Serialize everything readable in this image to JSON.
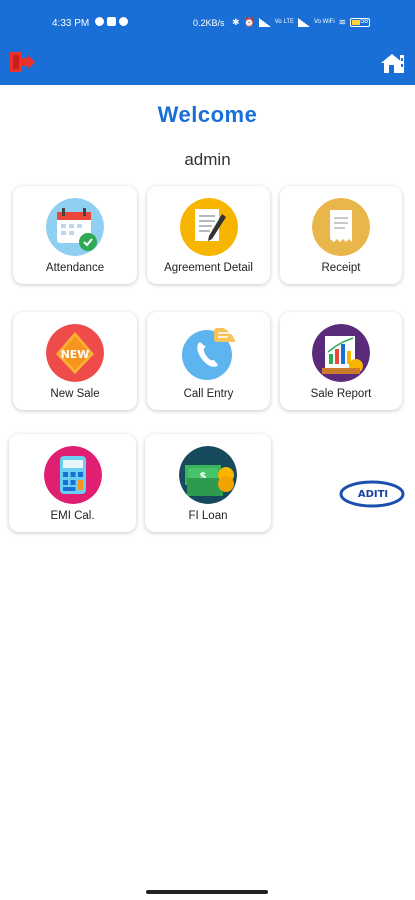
{
  "status_bar": {
    "time": "4:33 PM",
    "net_speed": "0.2KB/s",
    "volte_1": "Vo LTE",
    "volte_2": "Vo WiFi",
    "battery": "58"
  },
  "app_bar": {
    "left_icon": "logout-icon",
    "right_icon": "home-icon",
    "color": "#1a6fd6"
  },
  "header": {
    "welcome": "Welcome",
    "username": "admin"
  },
  "menu": {
    "items": [
      {
        "label": "Attendance",
        "icon": "calendar-icon"
      },
      {
        "label": "Agreement Detail",
        "icon": "document-pen-icon"
      },
      {
        "label": "Receipt",
        "icon": "receipt-icon"
      },
      {
        "label": "New Sale",
        "icon": "new-tag-icon"
      },
      {
        "label": "Call Entry",
        "icon": "phone-icon"
      },
      {
        "label": "Sale Report",
        "icon": "report-chart-icon"
      },
      {
        "label": "EMI Cal.",
        "icon": "calculator-icon"
      },
      {
        "label": "FI Loan",
        "icon": "money-icon"
      }
    ]
  },
  "brand": {
    "logo_text": "ADITI"
  }
}
